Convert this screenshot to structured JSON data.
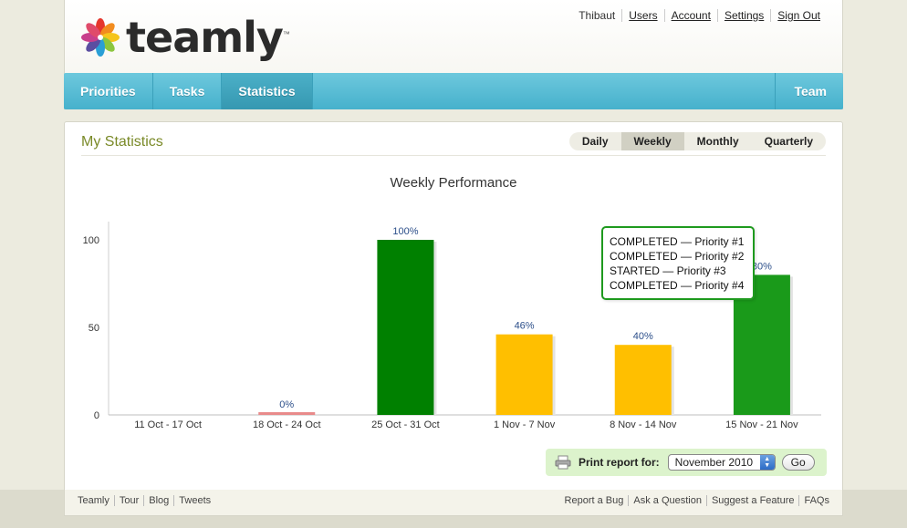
{
  "brand": {
    "name": "teamly",
    "tm": "™"
  },
  "user_nav": {
    "username": "Thibaut",
    "links": [
      "Users",
      "Account",
      "Settings",
      "Sign Out"
    ]
  },
  "main_nav": {
    "tabs": [
      "Priorities",
      "Tasks",
      "Statistics"
    ],
    "active_tab": "Statistics",
    "right_tab": "Team"
  },
  "panel": {
    "title": "My Statistics",
    "periods": [
      "Daily",
      "Weekly",
      "Monthly",
      "Quarterly"
    ],
    "active_period": "Weekly"
  },
  "chart_data": {
    "type": "bar",
    "title": "Weekly Performance",
    "categories": [
      "11 Oct - 17 Oct",
      "18 Oct - 24 Oct",
      "25 Oct - 31 Oct",
      "1 Nov - 7 Nov",
      "8 Nov - 14 Nov",
      "15 Nov - 21 Nov"
    ],
    "values": [
      null,
      0,
      100,
      46,
      40,
      80
    ],
    "labels": [
      "",
      "0%",
      "100%",
      "46%",
      "40%",
      "80%"
    ],
    "colors": [
      "#e88a8a",
      "#e88a8a",
      "#008000",
      "#ffbf00",
      "#ffbf00",
      "#1a9a1a"
    ],
    "yticks": [
      0,
      50,
      100
    ],
    "ylim": [
      0,
      100
    ],
    "xlabel": "",
    "ylabel": ""
  },
  "tooltip": {
    "lines": [
      "COMPLETED — Priority #1",
      "COMPLETED — Priority #2",
      "STARTED — Priority #3",
      "COMPLETED — Priority #4"
    ]
  },
  "print": {
    "label": "Print report for:",
    "selected": "November 2010",
    "go_label": "Go"
  },
  "footer": {
    "left_links": [
      "Teamly",
      "Tour",
      "Blog",
      "Tweets"
    ],
    "right_links": [
      "Report a Bug",
      "Ask a Question",
      "Suggest a Feature",
      "FAQs"
    ]
  },
  "colors": {
    "nav": "#46b1cc",
    "title_green": "#7a8a28",
    "print_bg": "#dcf3cc",
    "tooltip_border": "#1e9a1e"
  }
}
